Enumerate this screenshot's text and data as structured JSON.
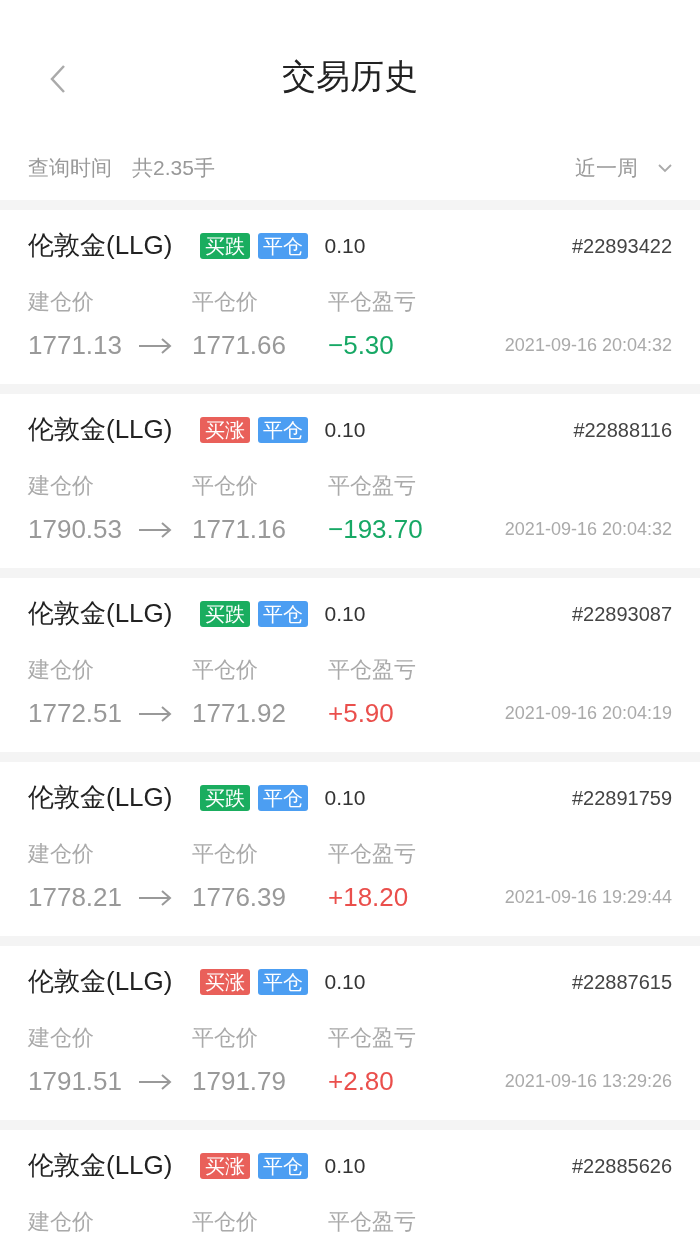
{
  "header": {
    "title": "交易历史"
  },
  "filter": {
    "label": "查询时间",
    "total": "共2.35手",
    "period": "近一周"
  },
  "trades": [
    {
      "name": "伦敦金(LLG)",
      "direction": {
        "text": "买跌",
        "color": "#1aad5f"
      },
      "action": {
        "text": "平仓",
        "color": "#4c9ef2"
      },
      "lots": "0.10",
      "id": "#22893422",
      "labels": [
        "建仓价",
        "平仓价",
        "平仓盈亏"
      ],
      "open": "1771.13",
      "close": "1771.66",
      "pnl": {
        "text": "−5.30",
        "kind": "loss"
      },
      "time": "2021-09-16 20:04:32"
    },
    {
      "name": "伦敦金(LLG)",
      "direction": {
        "text": "买涨",
        "color": "#e9605a"
      },
      "action": {
        "text": "平仓",
        "color": "#4c9ef2"
      },
      "lots": "0.10",
      "id": "#22888116",
      "labels": [
        "建仓价",
        "平仓价",
        "平仓盈亏"
      ],
      "open": "1790.53",
      "close": "1771.16",
      "pnl": {
        "text": "−193.70",
        "kind": "loss"
      },
      "time": "2021-09-16 20:04:32"
    },
    {
      "name": "伦敦金(LLG)",
      "direction": {
        "text": "买跌",
        "color": "#1aad5f"
      },
      "action": {
        "text": "平仓",
        "color": "#4c9ef2"
      },
      "lots": "0.10",
      "id": "#22893087",
      "labels": [
        "建仓价",
        "平仓价",
        "平仓盈亏"
      ],
      "open": "1772.51",
      "close": "1771.92",
      "pnl": {
        "text": "+5.90",
        "kind": "gain"
      },
      "time": "2021-09-16 20:04:19"
    },
    {
      "name": "伦敦金(LLG)",
      "direction": {
        "text": "买跌",
        "color": "#1aad5f"
      },
      "action": {
        "text": "平仓",
        "color": "#4c9ef2"
      },
      "lots": "0.10",
      "id": "#22891759",
      "labels": [
        "建仓价",
        "平仓价",
        "平仓盈亏"
      ],
      "open": "1778.21",
      "close": "1776.39",
      "pnl": {
        "text": "+18.20",
        "kind": "gain"
      },
      "time": "2021-09-16 19:29:44"
    },
    {
      "name": "伦敦金(LLG)",
      "direction": {
        "text": "买涨",
        "color": "#e9605a"
      },
      "action": {
        "text": "平仓",
        "color": "#4c9ef2"
      },
      "lots": "0.10",
      "id": "#22887615",
      "labels": [
        "建仓价",
        "平仓价",
        "平仓盈亏"
      ],
      "open": "1791.51",
      "close": "1791.79",
      "pnl": {
        "text": "+2.80",
        "kind": "gain"
      },
      "time": "2021-09-16 13:29:26"
    },
    {
      "name": "伦敦金(LLG)",
      "direction": {
        "text": "买涨",
        "color": "#e9605a"
      },
      "action": {
        "text": "平仓",
        "color": "#4c9ef2"
      },
      "lots": "0.10",
      "id": "#22885626",
      "labels": [
        "建仓价",
        "平仓价",
        "平仓盈亏"
      ]
    }
  ]
}
